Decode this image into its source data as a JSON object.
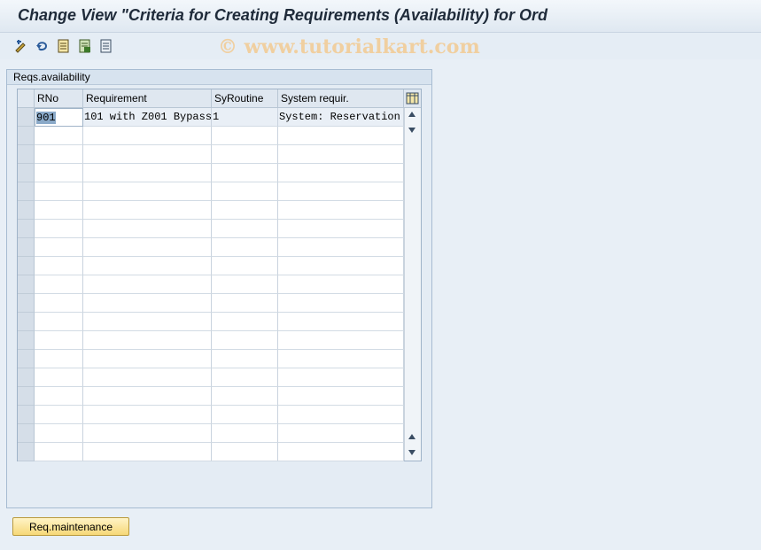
{
  "window": {
    "title": "Change View \"Criteria for Creating Requirements (Availability) for Ord"
  },
  "watermark": "© www.tutorialkart.com",
  "toolbar": {
    "icons": [
      "display-change-icon",
      "undo-icon",
      "new-entries-icon",
      "copy-icon",
      "delete-icon"
    ]
  },
  "group": {
    "title": "Reqs.availability"
  },
  "table": {
    "columns": [
      "RNo",
      "Requirement",
      "SyRoutine",
      "System requir."
    ],
    "rows": [
      [
        "901",
        "101 with Z001 Bypass",
        "1",
        "System: Reservation"
      ]
    ],
    "empty_rows": 18
  },
  "footer": {
    "button_label": "Req.maintenance"
  },
  "colors": {
    "accent": "#f6d877",
    "header": "#dfe7f0",
    "background": "#e8eff6"
  }
}
